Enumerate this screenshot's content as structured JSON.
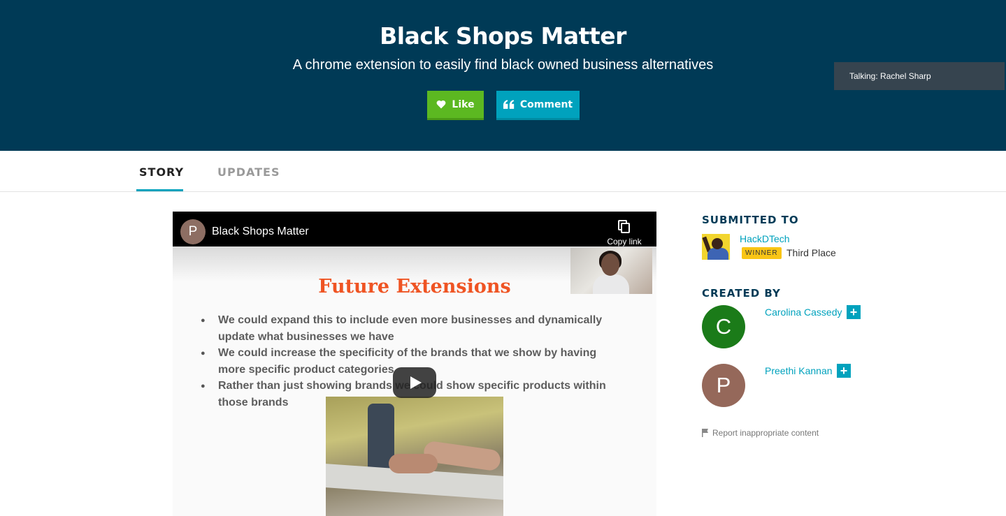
{
  "hero": {
    "title": "Black Shops Matter",
    "subtitle": "A chrome extension to easily find black owned business alternatives",
    "like_label": "Like",
    "comment_label": "Comment",
    "like_color": "#5cb821",
    "comment_color": "#00a2bd",
    "background_color": "#003a56"
  },
  "toast": {
    "text": "Talking: Rachel Sharp"
  },
  "tabs": [
    {
      "label": "STORY",
      "active": true
    },
    {
      "label": "UPDATES",
      "active": false
    }
  ],
  "video": {
    "channel_initial": "P",
    "title": "Black Shops Matter",
    "copy_link_label": "Copy link",
    "slide_heading": "Future Extensions",
    "bullets": [
      "We could expand this to include even more businesses and dynamically update what businesses we have",
      "We could increase the specificity of the brands that we show by having more specific product categories",
      "Rather than just showing brands we could show specific products within those brands"
    ]
  },
  "sidebar": {
    "submitted_heading": "SUBMITTED TO",
    "hackathon_name": "HackDTech",
    "winner_badge": "WINNER",
    "prize": "Third Place",
    "created_heading": "CREATED BY",
    "creators": [
      {
        "initial": "C",
        "name": "Carolina Cassedy",
        "avatar_color": "#1b7b19"
      },
      {
        "initial": "P",
        "name": "Preethi Kannan",
        "avatar_color": "#95685a"
      }
    ],
    "follow_symbol": "+",
    "report_label": "Report inappropriate content"
  }
}
